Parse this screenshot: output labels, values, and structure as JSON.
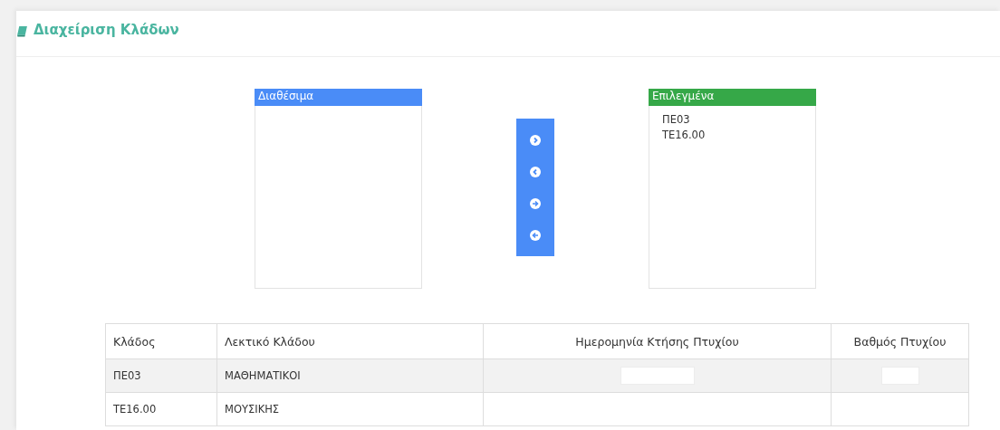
{
  "title": "Διαχείριση Κλάδων",
  "available": {
    "header": "Διαθέσιμα"
  },
  "transfer_buttons": [
    {
      "kind": "move-right"
    },
    {
      "kind": "move-left"
    },
    {
      "kind": "move-all-right"
    },
    {
      "kind": "move-all-left"
    }
  ],
  "selected_list": {
    "header": "Επιλεγμένα",
    "items": [
      "ΠΕ03",
      "ΤΕ16.00"
    ]
  },
  "table": {
    "columns": [
      "Κλάδος",
      "Λεκτικό Κλάδου",
      "Ημερομηνία Κτήσης Πτυχίου",
      "Βαθμός Πτυχίου"
    ],
    "rows": [
      {
        "cells": [
          "ΠΕ03",
          "ΜΑΘΗΜΑΤΙΚΟΙ"
        ],
        "editable": true
      },
      {
        "cells": [
          "ΤΕ16.00",
          "ΜΟΥΣΙΚΗΣ"
        ],
        "editable": false
      }
    ]
  }
}
